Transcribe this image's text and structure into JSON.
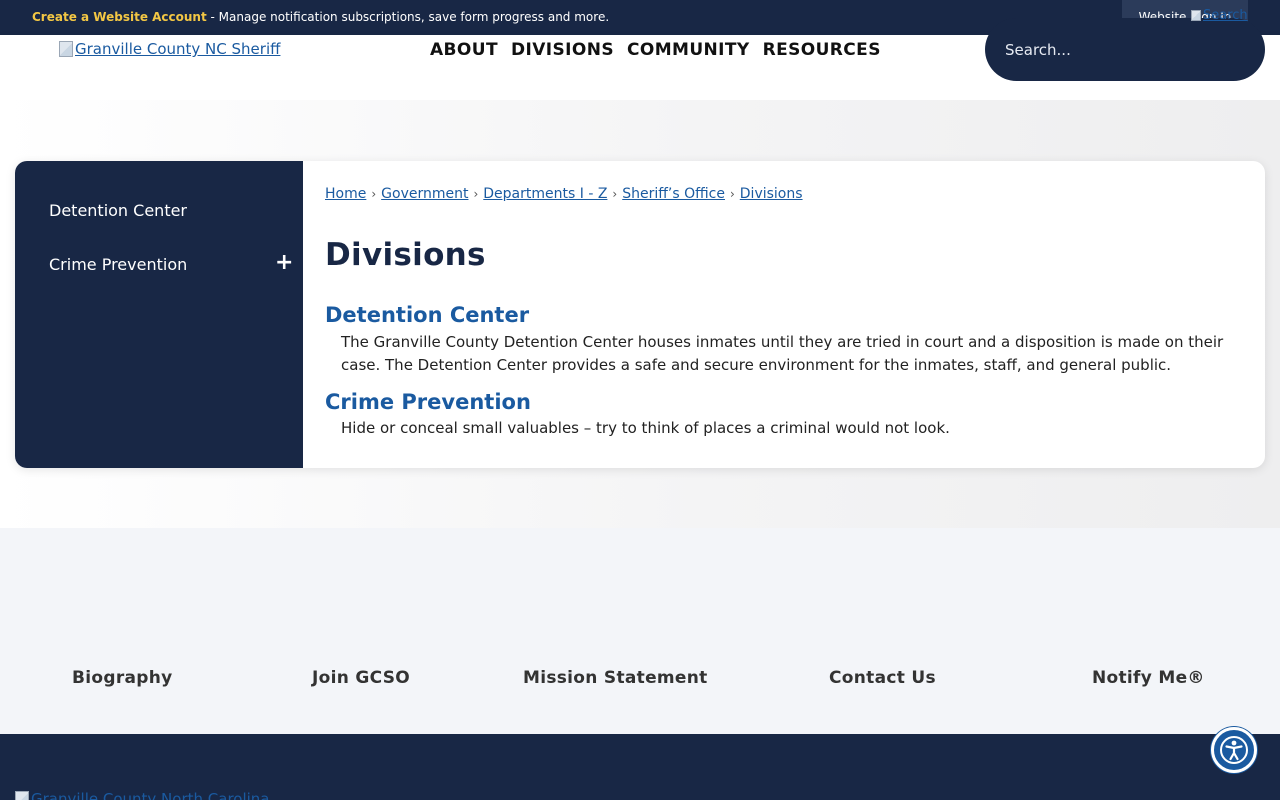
{
  "topbar": {
    "create_account": "Create a Website Account",
    "message": " - Manage notification subscriptions, save form progress and more.",
    "signin": "Website Sign In"
  },
  "header": {
    "logo_alt": "Granville County NC Sheriff",
    "nav": [
      "ABOUT",
      "DIVISIONS",
      "COMMUNITY",
      "RESOURCES"
    ],
    "search_placeholder": "Search...",
    "search_button": "Search"
  },
  "sidebar": {
    "items": [
      {
        "label": "Detention Center"
      },
      {
        "label": "Crime Prevention",
        "expand": "+"
      }
    ]
  },
  "breadcrumb": [
    "Home",
    "Government",
    "Departments I - Z",
    "Sheriff’s Office",
    "Divisions"
  ],
  "breadcrumb_sep": "›",
  "page_title": "Divisions",
  "sections": [
    {
      "title": "Detention Center",
      "desc": "The Granville County Detention Center houses inmates until they are tried in court and a disposition is made on their case. The Detention Center provides a safe and secure environment for the inmates, staff, and general public."
    },
    {
      "title": "Crime Prevention",
      "desc": "Hide or conceal small valuables – try to think of places a criminal would not look."
    }
  ],
  "footer_links": [
    "Biography",
    "Join GCSO",
    "Mission Statement",
    "Contact Us",
    "Notify Me®"
  ],
  "footer": {
    "logo_alt": "Granville County North Carolina"
  },
  "colors": {
    "navy": "#182745",
    "link": "#1a5aa0",
    "highlight": "#f3c744"
  },
  "icons": {
    "accessibility": "accessibility-icon",
    "broken_image": "broken-image-icon"
  }
}
